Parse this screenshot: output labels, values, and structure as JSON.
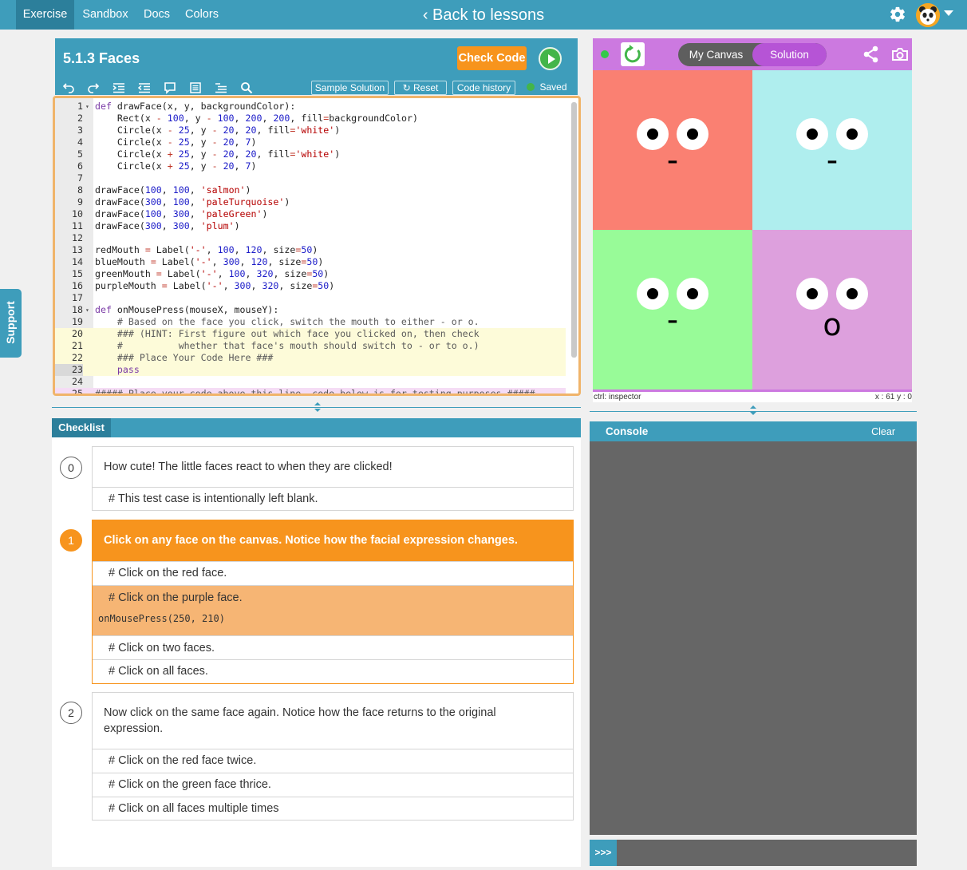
{
  "nav": {
    "tabs": [
      "Exercise",
      "Sandbox",
      "Docs",
      "Colors"
    ],
    "back_label": "‹ Back to lessons",
    "settings_icon": "gear-icon",
    "avatar_icon": "panda-avatar-icon"
  },
  "support": {
    "label": "Support"
  },
  "editor": {
    "title": "5.1.3 Faces",
    "check_label": "Check Code",
    "toolbar_icons": [
      "undo-icon",
      "redo-icon",
      "indent-icon",
      "outdent-icon",
      "comment-icon",
      "format-icon",
      "list-icon",
      "search-icon"
    ],
    "sample_label": "Sample Solution",
    "reset_label": "Reset",
    "history_label": "Code history",
    "saved_label": "Saved",
    "lines": [
      "def drawFace(x, y, backgroundColor):",
      "    Rect(x - 100, y - 100, 200, 200, fill=backgroundColor)",
      "    Circle(x - 25, y - 20, 20, fill='white')",
      "    Circle(x - 25, y - 20, 7)",
      "    Circle(x + 25, y - 20, 20, fill='white')",
      "    Circle(x + 25, y - 20, 7)",
      "",
      "drawFace(100, 100, 'salmon')",
      "drawFace(300, 100, 'paleTurquoise')",
      "drawFace(100, 300, 'paleGreen')",
      "drawFace(300, 300, 'plum')",
      "",
      "redMouth = Label('-', 100, 120, size=50)",
      "blueMouth = Label('-', 300, 120, size=50)",
      "greenMouth = Label('-', 100, 320, size=50)",
      "purpleMouth = Label('-', 300, 320, size=50)",
      "",
      "def onMousePress(mouseX, mouseY):",
      "    # Based on the face you click, switch the mouth to either - or o.",
      "    ### (HINT: First figure out which face you clicked on, then check",
      "    #          whether that face's mouth should switch to - or to o.)",
      "    ### Place Your Code Here ###",
      "    pass",
      "",
      "##### Place your code above this line, code below is for testing purposes #####"
    ]
  },
  "checklist": {
    "tab_label": "Checklist",
    "steps": [
      {
        "number": "0",
        "title": "How cute! The little faces react to when they are clicked!",
        "tests": [
          "# This test case is intentionally left blank."
        ]
      },
      {
        "number": "1",
        "title": "Click on any face on the canvas. Notice how the facial expression changes.",
        "tests": [
          "# Click on the red face.",
          "# Click on the purple face.",
          "# Click on two faces.",
          "# Click on all faces."
        ],
        "active_test_code": "onMousePress(250, 210)"
      },
      {
        "number": "2",
        "title_line1": "Now click on the same face again. Notice how the face returns to the original",
        "title_line2": "expression.",
        "tests": [
          "# Click on the red face twice.",
          "# Click on the green face thrice.",
          "# Click on all faces multiple times"
        ]
      }
    ]
  },
  "canvas": {
    "tabs": [
      "My Canvas",
      "Solution"
    ],
    "selected_tab": "Solution",
    "icons": [
      "refresh-icon",
      "share-icon",
      "camera-icon"
    ],
    "faces": [
      {
        "color": "#fa8072",
        "mouth": "-"
      },
      {
        "color": "#afeeee",
        "mouth": "-"
      },
      {
        "color": "#98fb98",
        "mouth": "-"
      },
      {
        "color": "#dda0dd",
        "mouth": "o"
      }
    ],
    "footer_left": "ctrl: inspector",
    "footer_right": "x : 61 y : 0"
  },
  "console": {
    "title": "Console",
    "clear_label": "Clear",
    "prompt": ">>>"
  },
  "colors": {
    "brand": "#3e9dbb",
    "accent_orange": "#f7941d",
    "canvas_toolbar": "#cc79e0"
  }
}
